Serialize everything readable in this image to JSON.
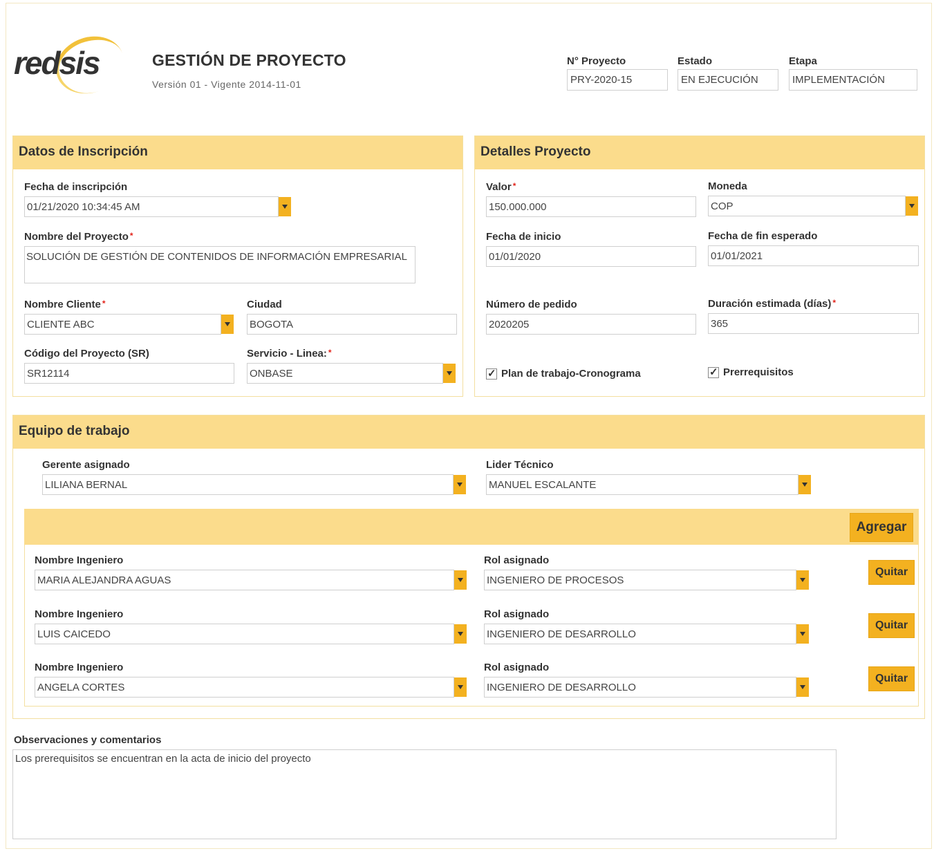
{
  "header": {
    "logo_text": "redsis",
    "title": "GESTIÓN DE PROYECTO",
    "version": "Versión 01 - Vigente 2014-11-01",
    "fields": [
      {
        "label": "N° Proyecto",
        "value": "PRY-2020-15"
      },
      {
        "label": "Estado",
        "value": "EN EJECUCIÓN"
      },
      {
        "label": "Etapa",
        "value": "IMPLEMENTACIÓN"
      }
    ]
  },
  "inscripcion": {
    "title": "Datos de Inscripción",
    "fecha_label": "Fecha de inscripción",
    "fecha_value": "01/21/2020 10:34:45 AM",
    "nombre_label": "Nombre del Proyecto",
    "nombre_value": "SOLUCIÓN DE GESTIÓN DE CONTENIDOS DE INFORMACIÓN EMPRESARIAL",
    "cliente_label": "Nombre Cliente",
    "cliente_value": "CLIENTE ABC",
    "ciudad_label": "Ciudad",
    "ciudad_value": "BOGOTA",
    "codigo_label": "Código del Proyecto (SR)",
    "codigo_value": "SR12114",
    "servicio_label": "Servicio - Linea:",
    "servicio_value": "ONBASE"
  },
  "detalles": {
    "title": "Detalles Proyecto",
    "valor_label": "Valor",
    "valor_value": "150.000.000",
    "moneda_label": "Moneda",
    "moneda_value": "COP",
    "inicio_label": "Fecha de inicio",
    "inicio_value": "01/01/2020",
    "fin_label": "Fecha de fin esperado",
    "fin_value": "01/01/2021",
    "pedido_label": "Número de pedido",
    "pedido_value": "2020205",
    "duracion_label": "Duración estimada (días)",
    "duracion_value": "365",
    "check_plan": "Plan de trabajo-Cronograma",
    "check_prerreq": "Prerrequisitos"
  },
  "equipo": {
    "title": "Equipo de trabajo",
    "gerente_label": "Gerente asignado",
    "gerente_value": "LILIANA BERNAL",
    "lider_label": "Lider Técnico",
    "lider_value": "MANUEL ESCALANTE",
    "add_label": "Agregar",
    "remove_label": "Quitar",
    "engineer_label": "Nombre Ingeniero",
    "role_label": "Rol asignado",
    "engineers": [
      {
        "name": "MARIA ALEJANDRA AGUAS",
        "role": "INGENIERO DE PROCESOS"
      },
      {
        "name": "LUIS CAICEDO",
        "role": "INGENIERO DE DESARROLLO"
      },
      {
        "name": "ANGELA CORTES",
        "role": "INGENIERO DE DESARROLLO"
      }
    ]
  },
  "observaciones": {
    "label": "Observaciones y comentarios",
    "value": "Los prerequisitos se encuentran en la acta de inicio del proyecto"
  },
  "colors": {
    "accent": "#f3b120",
    "panel_header": "#fbdc8c",
    "required": "#e2231a"
  }
}
